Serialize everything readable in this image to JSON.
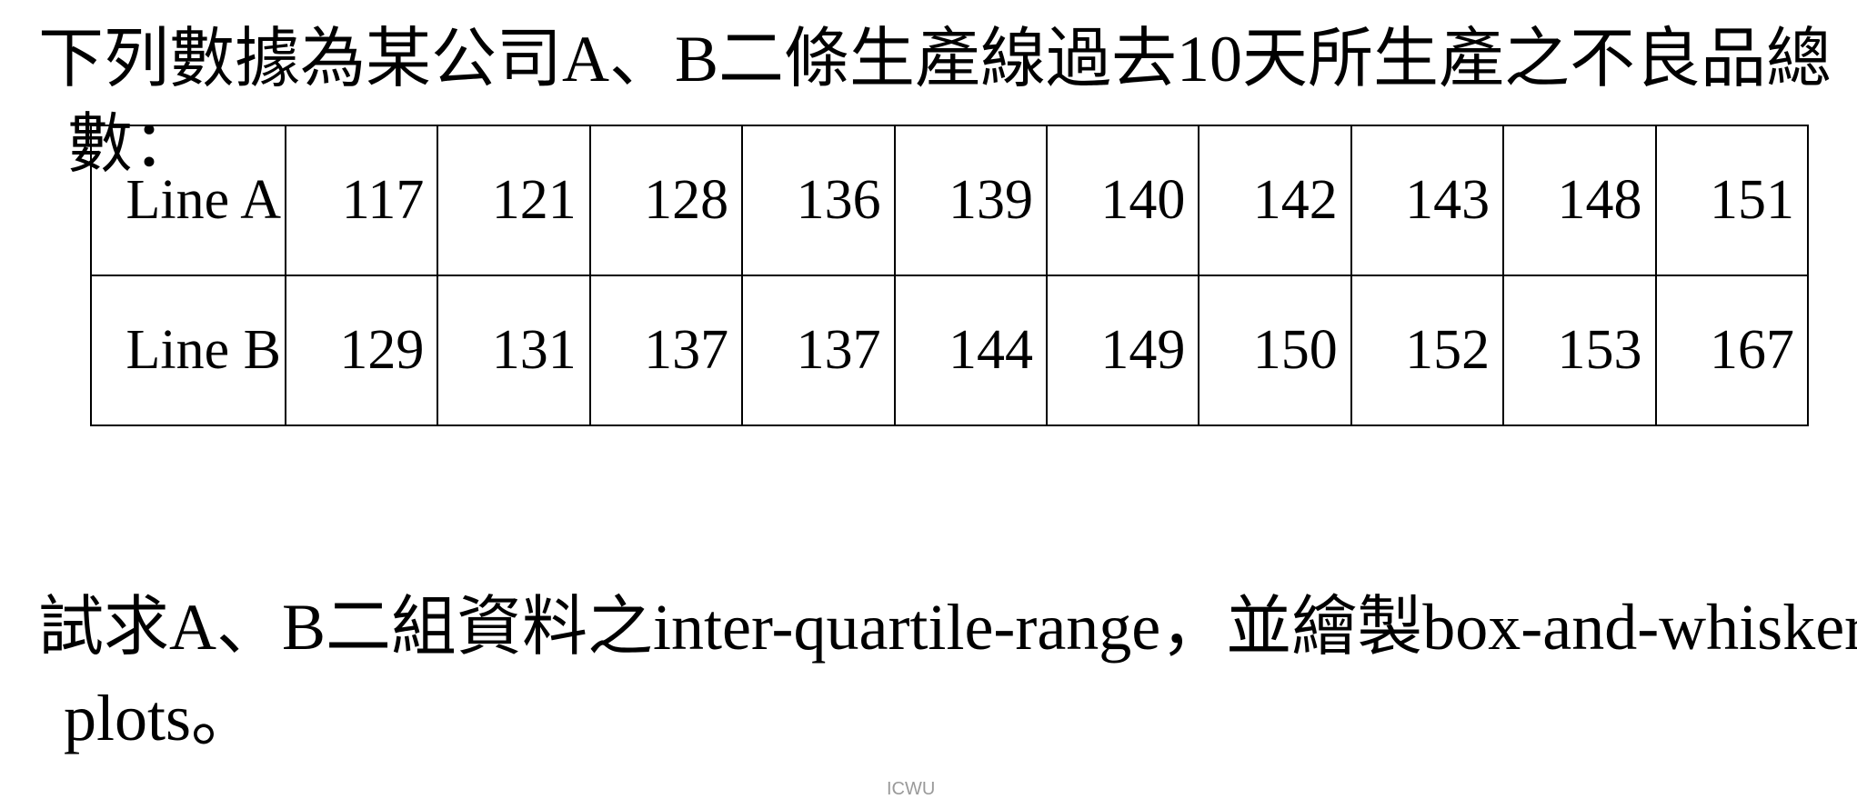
{
  "intro": {
    "line1": "下列數據為某公司A、B二條生產線過去10天所生產之不良品總",
    "line2": "數："
  },
  "table": {
    "rows": [
      {
        "label": "Line A",
        "values": [
          "117",
          "121",
          "128",
          "136",
          "139",
          "140",
          "142",
          "143",
          "148",
          "151"
        ]
      },
      {
        "label": "Line B",
        "values": [
          "129",
          "131",
          "137",
          "137",
          "144",
          "149",
          "150",
          "152",
          "153",
          "167"
        ]
      }
    ]
  },
  "question": {
    "line1": "試求A、B二組資料之inter-quartile-range，並繪製box-and-whisker",
    "line2": "plots。"
  },
  "watermark": "ICWU"
}
